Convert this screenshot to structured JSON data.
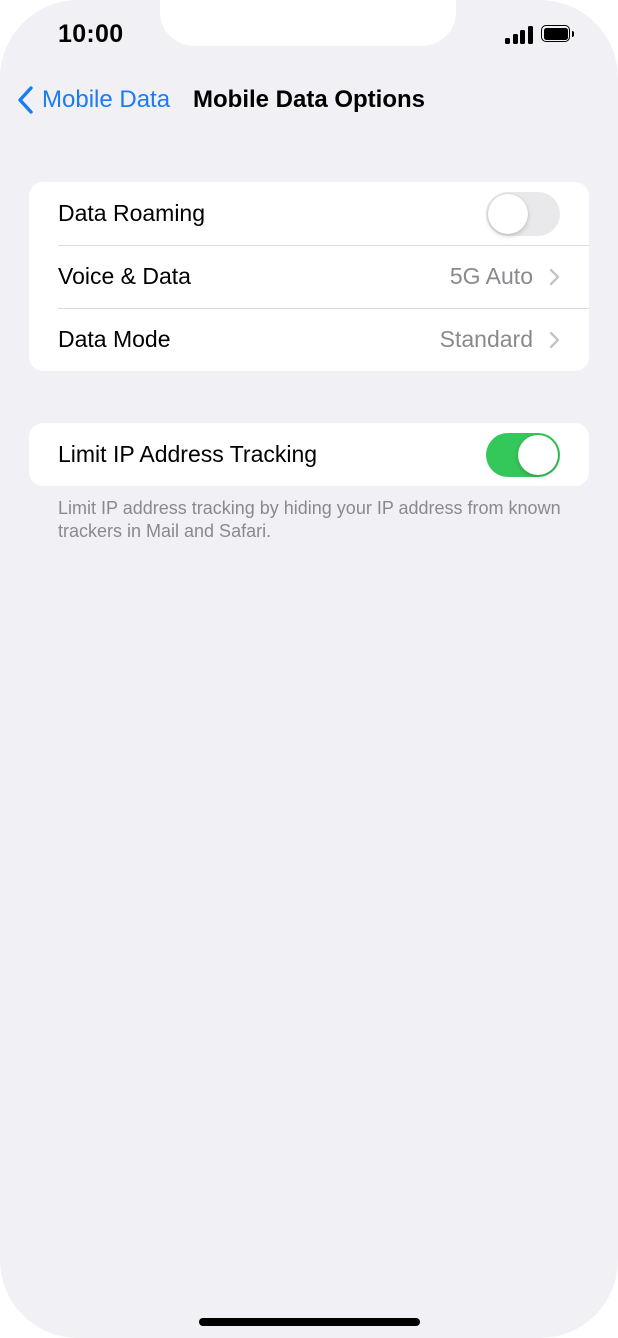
{
  "status_bar": {
    "time": "10:00",
    "signal_icon": "cellular-signal-icon",
    "battery_icon": "battery-icon",
    "battery_level": 1.0
  },
  "nav": {
    "back_label": "Mobile Data",
    "title": "Mobile Data Options"
  },
  "groups": {
    "network": {
      "data_roaming": {
        "label": "Data Roaming",
        "enabled": false
      },
      "voice_data": {
        "label": "Voice & Data",
        "value": "5G Auto"
      },
      "data_mode": {
        "label": "Data Mode",
        "value": "Standard"
      }
    },
    "privacy": {
      "limit_ip": {
        "label": "Limit IP Address Tracking",
        "enabled": true
      },
      "footer": "Limit IP address tracking by hiding your IP address from known trackers in Mail and Safari."
    }
  },
  "colors": {
    "accent": "#1a7cf4",
    "toggle_on": "#34c759",
    "toggle_off": "#e9e9eb",
    "background": "#f1f0f5",
    "secondary_text": "#8a8a8e"
  }
}
